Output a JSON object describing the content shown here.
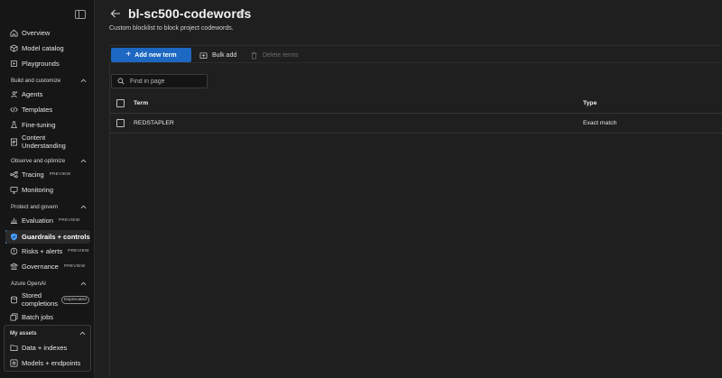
{
  "sidebar": {
    "items": [
      {
        "label": "Overview"
      },
      {
        "label": "Model catalog"
      },
      {
        "label": "Playgrounds"
      },
      {
        "label": "Agents"
      },
      {
        "label": "Templates"
      },
      {
        "label": "Fine-tuning"
      },
      {
        "label": "Content",
        "label2": "Understanding"
      },
      {
        "label": "Tracing",
        "badge": "PREVIEW"
      },
      {
        "label": "Monitoring"
      },
      {
        "label": "Evaluation",
        "badge": "PREVIEW"
      },
      {
        "label": "Guardrails + controls"
      },
      {
        "label": "Risks + alerts",
        "badge": "PREVIEW"
      },
      {
        "label": "Governance",
        "badge": "PREVIEW"
      },
      {
        "label": "Stored",
        "label2": "completions",
        "badge": "Deprecated"
      },
      {
        "label": "Batch jobs"
      },
      {
        "label": "Data + indexes"
      },
      {
        "label": "Models + endpoints"
      }
    ],
    "sections": {
      "build": "Build and customize",
      "observe": "Observe and optimize",
      "protect": "Protect and govern",
      "azure_openai": "Azure OpenAI",
      "my_assets": "My assets"
    }
  },
  "page": {
    "title": "bl-sc500-codewords",
    "subtitle": "Custom blocklist to block project codewords."
  },
  "toolbar": {
    "add_label": "Add new term",
    "bulk_label": "Bulk add",
    "delete_label": "Delete terms"
  },
  "search": {
    "placeholder": "Find in page"
  },
  "table": {
    "headers": {
      "term": "Term",
      "type": "Type"
    },
    "rows": [
      {
        "term": "REDSTAPLER",
        "type": "Exact match"
      }
    ]
  },
  "colors": {
    "accent": "#1d68c2",
    "active_indicator": "#4aa0ff",
    "background": "#1f1f1f",
    "sidebar": "#161616"
  }
}
